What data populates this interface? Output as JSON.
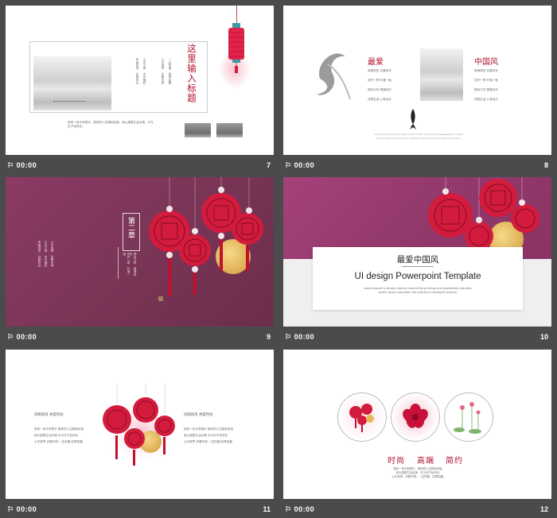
{
  "time_label": "00:00",
  "slides": [
    {
      "number": "7",
      "title": "这里输入标题",
      "paragraph": "祝你一世平安快乐，愿你的人生精彩纷呈。用心感受生活点滴，平凡日子也闪光。",
      "col1": "风雨同舟 共度时光",
      "col2": "山水之间 岁月静好",
      "col3": "心中有梦 步履不停",
      "col4": "一生所爱 四季如春"
    },
    {
      "number": "8",
      "h1": "最爱",
      "h2": "中国风",
      "left_lines": [
        "风雨同舟 共度时光",
        "花开一季 叶落一秋",
        "明月几时 把酒问天",
        "诗意生活 心有远方"
      ],
      "right_lines": [
        "风雨同舟 共度时光",
        "花开一季 叶落一秋",
        "明月几时 把酒问天",
        "诗意生活 心有远方"
      ],
      "footnote1": "Lorem ipsum is simply dummy text of the printing and typesetting industry.",
      "footnote2": "Lorem Ipsum has been the industry's standard dummy text ever since."
    },
    {
      "number": "9",
      "chapter": "第二章",
      "col_a": "风雨同舟 共度时光",
      "col_b": "山水之间 岁月静好",
      "col_c": "心中有梦 步履不停",
      "col_d": "花开一季 叶落一秋",
      "col_e": "明月几时 把酒问天"
    },
    {
      "number": "10",
      "title_cn": "最爱中国风",
      "title_en": "UI design Powerpoint Template",
      "body": "Lorem Ipsum is simply dummy text of the printing and typesetting industry. Lorem Ipsum has been the industry's standard dummy."
    },
    {
      "number": "11",
      "left_heading": "风雨同舟 共度时光",
      "left_lines": [
        "祝你一世平安快乐 愿你的人生精彩纷呈",
        "用心感受生活点滴 平凡日子也闪光",
        "心中有梦 步履不停 一生所爱 四季如春"
      ],
      "right_heading": "风雨同舟 共度时光",
      "right_lines": [
        "祝你一世平安快乐 愿你的人生精彩纷呈",
        "用心感受生活点滴 平凡日子也闪光",
        "心中有梦 步履不停 一生所爱 四季如春"
      ]
    },
    {
      "number": "12",
      "w1": "时尚",
      "w2": "高端",
      "w3": "简约",
      "cap1": "祝你一世平安快乐，愿你的人生精彩纷呈。",
      "cap2": "用心感受生活点滴，平凡日子也闪光。",
      "cap3": "心中有梦，步履不停，一生所爱，四季如春。"
    }
  ]
}
